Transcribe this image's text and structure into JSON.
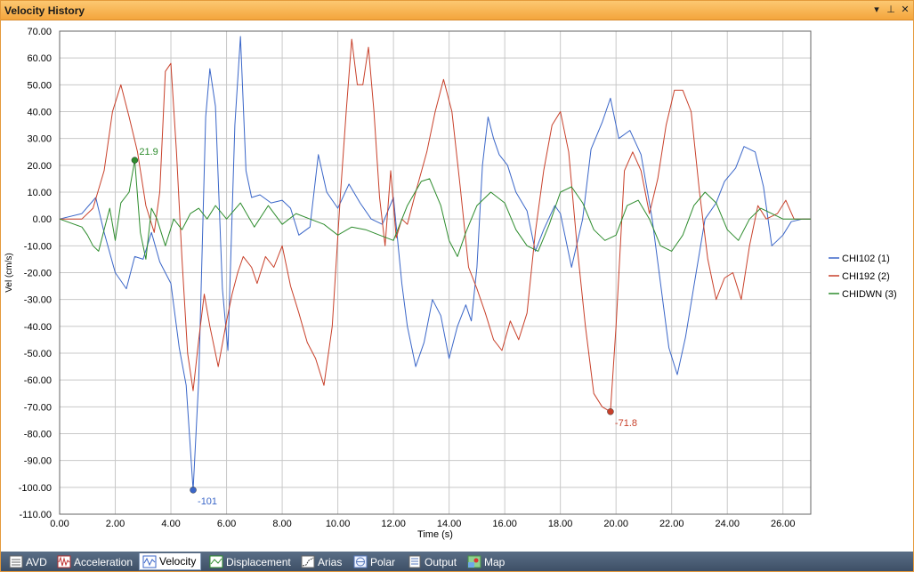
{
  "window": {
    "title": "Velocity History",
    "buttons": [
      {
        "name": "dropdown-icon",
        "glyph": "▾"
      },
      {
        "name": "pin-icon",
        "glyph": "⊥"
      },
      {
        "name": "close-icon",
        "glyph": "✕"
      }
    ]
  },
  "tabs": [
    {
      "label": "AVD",
      "icon": "avd-icon",
      "active": false
    },
    {
      "label": "Acceleration",
      "icon": "acceleration-icon",
      "active": false
    },
    {
      "label": "Velocity",
      "icon": "velocity-icon",
      "active": true
    },
    {
      "label": "Displacement",
      "icon": "displacement-icon",
      "active": false
    },
    {
      "label": "Arias",
      "icon": "arias-icon",
      "active": false
    },
    {
      "label": "Polar",
      "icon": "polar-icon",
      "active": false
    },
    {
      "label": "Output",
      "icon": "output-icon",
      "active": false
    },
    {
      "label": "Map",
      "icon": "map-icon",
      "active": false
    }
  ],
  "chart_data": {
    "type": "line",
    "title": "",
    "xlabel": "Time (s)",
    "ylabel": "Vel (cm/s)",
    "xlim": [
      0,
      27
    ],
    "ylim": [
      -110,
      70
    ],
    "xticks": [
      "0.00",
      "2.00",
      "4.00",
      "6.00",
      "8.00",
      "10.00",
      "12.00",
      "14.00",
      "16.00",
      "18.00",
      "20.00",
      "22.00",
      "24.00",
      "26.00"
    ],
    "yticks": [
      "70.00",
      "60.00",
      "50.00",
      "40.00",
      "30.00",
      "20.00",
      "10.00",
      "0.00",
      "-10.00",
      "-20.00",
      "-30.00",
      "-40.00",
      "-50.00",
      "-60.00",
      "-70.00",
      "-80.00",
      "-90.00",
      "-100.00",
      "-110.00"
    ],
    "grid": true,
    "legend_position": "right",
    "series": [
      {
        "name": "CHI102 (1)",
        "color": "#3a66c8",
        "peak": {
          "x": 4.8,
          "y": -101,
          "label": "-101"
        },
        "points": [
          [
            0,
            0
          ],
          [
            0.8,
            2
          ],
          [
            1.3,
            8
          ],
          [
            1.6,
            -5
          ],
          [
            2.0,
            -20
          ],
          [
            2.4,
            -26
          ],
          [
            2.7,
            -14
          ],
          [
            3.0,
            -15
          ],
          [
            3.3,
            -5
          ],
          [
            3.6,
            -16
          ],
          [
            4.0,
            -24
          ],
          [
            4.3,
            -48
          ],
          [
            4.55,
            -62
          ],
          [
            4.8,
            -101
          ],
          [
            5.0,
            -60
          ],
          [
            5.25,
            38
          ],
          [
            5.4,
            56
          ],
          [
            5.6,
            42
          ],
          [
            5.85,
            -26
          ],
          [
            6.05,
            -49
          ],
          [
            6.3,
            35
          ],
          [
            6.5,
            68
          ],
          [
            6.7,
            18
          ],
          [
            6.9,
            8
          ],
          [
            7.2,
            9
          ],
          [
            7.6,
            6
          ],
          [
            8.0,
            7
          ],
          [
            8.3,
            4
          ],
          [
            8.6,
            -6
          ],
          [
            9.0,
            -3
          ],
          [
            9.3,
            24
          ],
          [
            9.6,
            10
          ],
          [
            10.0,
            4
          ],
          [
            10.4,
            13
          ],
          [
            10.8,
            6
          ],
          [
            11.2,
            0
          ],
          [
            11.6,
            -2
          ],
          [
            12.0,
            8
          ],
          [
            12.3,
            -24
          ],
          [
            12.5,
            -40
          ],
          [
            12.8,
            -55
          ],
          [
            13.1,
            -46
          ],
          [
            13.4,
            -30
          ],
          [
            13.7,
            -36
          ],
          [
            14.0,
            -52
          ],
          [
            14.3,
            -40
          ],
          [
            14.6,
            -32
          ],
          [
            14.8,
            -38
          ],
          [
            15.0,
            -18
          ],
          [
            15.2,
            20
          ],
          [
            15.4,
            38
          ],
          [
            15.6,
            30
          ],
          [
            15.8,
            24
          ],
          [
            16.1,
            20
          ],
          [
            16.4,
            10
          ],
          [
            16.8,
            3
          ],
          [
            17.1,
            -12
          ],
          [
            17.4,
            -4
          ],
          [
            17.8,
            5
          ],
          [
            18.0,
            2
          ],
          [
            18.4,
            -18
          ],
          [
            18.8,
            0
          ],
          [
            19.1,
            26
          ],
          [
            19.5,
            36
          ],
          [
            19.8,
            45
          ],
          [
            20.1,
            30
          ],
          [
            20.5,
            33
          ],
          [
            20.9,
            24
          ],
          [
            21.3,
            0
          ],
          [
            21.6,
            -24
          ],
          [
            21.9,
            -48
          ],
          [
            22.2,
            -58
          ],
          [
            22.5,
            -44
          ],
          [
            22.8,
            -25
          ],
          [
            23.2,
            0
          ],
          [
            23.6,
            6
          ],
          [
            23.9,
            14
          ],
          [
            24.3,
            19
          ],
          [
            24.6,
            27
          ],
          [
            25.0,
            25
          ],
          [
            25.3,
            12
          ],
          [
            25.6,
            -10
          ],
          [
            25.8,
            -8
          ],
          [
            26.0,
            -6
          ],
          [
            26.3,
            -1
          ],
          [
            26.7,
            0
          ],
          [
            27.0,
            0
          ]
        ]
      },
      {
        "name": "CHI192 (2)",
        "color": "#c8402a",
        "peak": {
          "x": 19.8,
          "y": -71.8,
          "label": "-71.8"
        },
        "points": [
          [
            0,
            0
          ],
          [
            0.8,
            0
          ],
          [
            1.2,
            4
          ],
          [
            1.6,
            18
          ],
          [
            1.9,
            40
          ],
          [
            2.2,
            50
          ],
          [
            2.5,
            38
          ],
          [
            2.8,
            25
          ],
          [
            3.1,
            5
          ],
          [
            3.4,
            -5
          ],
          [
            3.6,
            10
          ],
          [
            3.8,
            55
          ],
          [
            4.0,
            58
          ],
          [
            4.2,
            25
          ],
          [
            4.4,
            -15
          ],
          [
            4.6,
            -50
          ],
          [
            4.8,
            -64
          ],
          [
            5.0,
            -45
          ],
          [
            5.2,
            -28
          ],
          [
            5.4,
            -40
          ],
          [
            5.7,
            -55
          ],
          [
            6.0,
            -38
          ],
          [
            6.2,
            -28
          ],
          [
            6.4,
            -20
          ],
          [
            6.6,
            -14
          ],
          [
            6.9,
            -18
          ],
          [
            7.1,
            -24
          ],
          [
            7.4,
            -14
          ],
          [
            7.7,
            -18
          ],
          [
            8.0,
            -10
          ],
          [
            8.3,
            -25
          ],
          [
            8.6,
            -35
          ],
          [
            8.9,
            -46
          ],
          [
            9.2,
            -52
          ],
          [
            9.5,
            -62
          ],
          [
            9.8,
            -40
          ],
          [
            10.1,
            10
          ],
          [
            10.3,
            40
          ],
          [
            10.5,
            67
          ],
          [
            10.7,
            50
          ],
          [
            10.9,
            50
          ],
          [
            11.1,
            64
          ],
          [
            11.3,
            40
          ],
          [
            11.5,
            8
          ],
          [
            11.7,
            -10
          ],
          [
            11.9,
            18
          ],
          [
            12.1,
            -7
          ],
          [
            12.3,
            0
          ],
          [
            12.5,
            -2
          ],
          [
            12.8,
            10
          ],
          [
            13.2,
            25
          ],
          [
            13.5,
            40
          ],
          [
            13.8,
            52
          ],
          [
            14.1,
            40
          ],
          [
            14.4,
            12
          ],
          [
            14.7,
            -18
          ],
          [
            15.0,
            -26
          ],
          [
            15.3,
            -35
          ],
          [
            15.6,
            -45
          ],
          [
            15.9,
            -49
          ],
          [
            16.2,
            -38
          ],
          [
            16.5,
            -45
          ],
          [
            16.8,
            -35
          ],
          [
            17.1,
            -5
          ],
          [
            17.4,
            18
          ],
          [
            17.7,
            35
          ],
          [
            18.0,
            40
          ],
          [
            18.3,
            25
          ],
          [
            18.6,
            -10
          ],
          [
            18.9,
            -40
          ],
          [
            19.2,
            -65
          ],
          [
            19.5,
            -70
          ],
          [
            19.8,
            -71.8
          ],
          [
            20.0,
            -40
          ],
          [
            20.3,
            18
          ],
          [
            20.6,
            25
          ],
          [
            20.9,
            18
          ],
          [
            21.2,
            2
          ],
          [
            21.5,
            15
          ],
          [
            21.8,
            35
          ],
          [
            22.1,
            48
          ],
          [
            22.4,
            48
          ],
          [
            22.7,
            40
          ],
          [
            23.0,
            10
          ],
          [
            23.3,
            -15
          ],
          [
            23.6,
            -30
          ],
          [
            23.9,
            -22
          ],
          [
            24.2,
            -20
          ],
          [
            24.5,
            -30
          ],
          [
            24.8,
            -10
          ],
          [
            25.1,
            5
          ],
          [
            25.4,
            0
          ],
          [
            25.8,
            2
          ],
          [
            26.1,
            7
          ],
          [
            26.4,
            0
          ],
          [
            27.0,
            0
          ]
        ]
      },
      {
        "name": "CHIDWN (3)",
        "color": "#2d8c2d",
        "peak": {
          "x": 2.7,
          "y": 21.9,
          "label": "21.9"
        },
        "points": [
          [
            0,
            0
          ],
          [
            0.8,
            -3
          ],
          [
            1.0,
            -6
          ],
          [
            1.2,
            -10
          ],
          [
            1.4,
            -12
          ],
          [
            1.6,
            -4
          ],
          [
            1.8,
            4
          ],
          [
            2.0,
            -8
          ],
          [
            2.2,
            6
          ],
          [
            2.5,
            10
          ],
          [
            2.7,
            21.9
          ],
          [
            2.9,
            -5
          ],
          [
            3.1,
            -15
          ],
          [
            3.3,
            4
          ],
          [
            3.5,
            0
          ],
          [
            3.8,
            -10
          ],
          [
            4.1,
            0
          ],
          [
            4.4,
            -4
          ],
          [
            4.7,
            2
          ],
          [
            5.0,
            4
          ],
          [
            5.3,
            0
          ],
          [
            5.6,
            5
          ],
          [
            6.0,
            0
          ],
          [
            6.5,
            6
          ],
          [
            7.0,
            -3
          ],
          [
            7.5,
            5
          ],
          [
            8.0,
            -2
          ],
          [
            8.5,
            2
          ],
          [
            9.0,
            0
          ],
          [
            9.5,
            -2
          ],
          [
            10.0,
            -6
          ],
          [
            10.5,
            -3
          ],
          [
            11.0,
            -4
          ],
          [
            11.5,
            -6
          ],
          [
            12.0,
            -8
          ],
          [
            12.5,
            5
          ],
          [
            13.0,
            14
          ],
          [
            13.3,
            15
          ],
          [
            13.7,
            5
          ],
          [
            14.0,
            -8
          ],
          [
            14.3,
            -14
          ],
          [
            14.6,
            -5
          ],
          [
            15.0,
            5
          ],
          [
            15.5,
            10
          ],
          [
            16.0,
            6
          ],
          [
            16.4,
            -4
          ],
          [
            16.8,
            -10
          ],
          [
            17.2,
            -12
          ],
          [
            17.6,
            -2
          ],
          [
            18.0,
            10
          ],
          [
            18.4,
            12
          ],
          [
            18.8,
            6
          ],
          [
            19.2,
            -4
          ],
          [
            19.6,
            -8
          ],
          [
            20.0,
            -6
          ],
          [
            20.4,
            5
          ],
          [
            20.8,
            7
          ],
          [
            21.2,
            0
          ],
          [
            21.6,
            -10
          ],
          [
            22.0,
            -12
          ],
          [
            22.4,
            -6
          ],
          [
            22.8,
            5
          ],
          [
            23.2,
            10
          ],
          [
            23.6,
            6
          ],
          [
            24.0,
            -4
          ],
          [
            24.4,
            -8
          ],
          [
            24.8,
            0
          ],
          [
            25.2,
            4
          ],
          [
            25.6,
            2
          ],
          [
            26.0,
            0
          ],
          [
            26.5,
            0
          ],
          [
            27.0,
            0
          ]
        ]
      }
    ]
  }
}
